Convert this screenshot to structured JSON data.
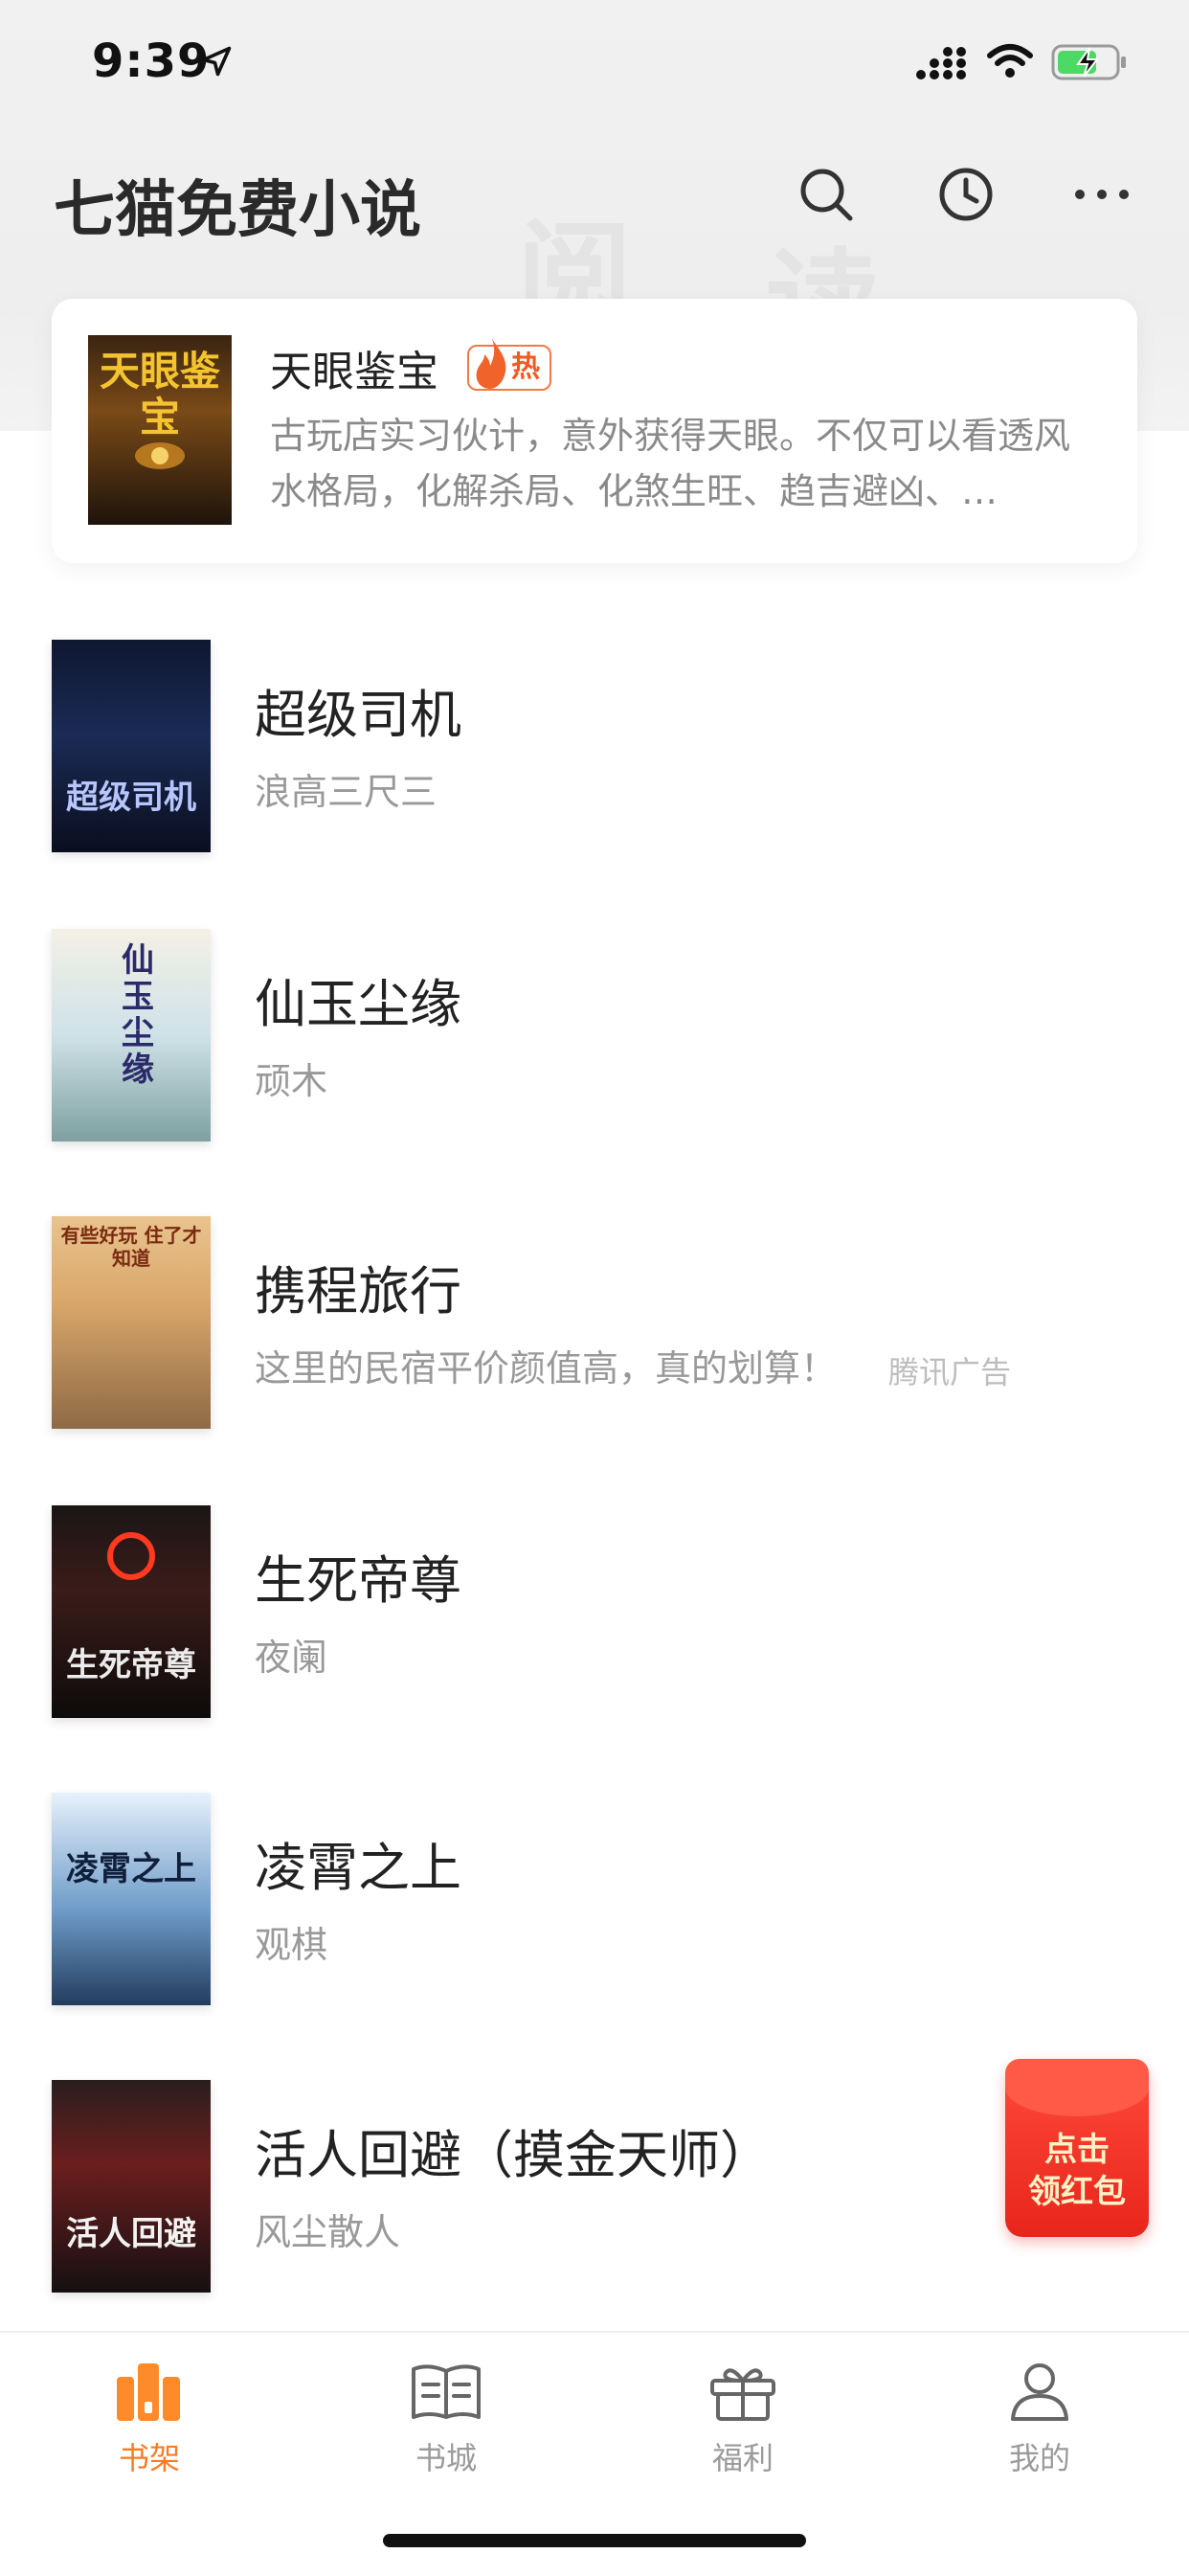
{
  "status_bar": {
    "time": "9:39"
  },
  "header": {
    "title": "七猫免费小说",
    "icons": [
      "search-icon",
      "history-clock-icon",
      "more-icon"
    ]
  },
  "promo": {
    "title": "天眼鉴宝",
    "badge": "热",
    "description": "古玩店实习伙计，意外获得天眼。不仅可以看透风水格局，化解杀局、化煞生旺、趋吉避凶、…",
    "cover_text": "天眼鉴宝"
  },
  "books": [
    {
      "title": "超级司机",
      "author": "浪高三尺三",
      "cover_text": "超级司机"
    },
    {
      "title": "仙玉尘缘",
      "author": "顽木",
      "cover_text": "仙玉尘缘"
    },
    {
      "title": "携程旅行",
      "author": "这里的民宿平价颜值高，真的划算！",
      "ad_tag": "腾讯广告",
      "cover_text": "有些好玩 住了才知道"
    },
    {
      "title": "生死帝尊",
      "author": "夜阑",
      "cover_text": "生死帝尊"
    },
    {
      "title": "凌霄之上",
      "author": "观棋",
      "cover_text": "凌霄之上"
    },
    {
      "title": "活人回避（摸金天师）",
      "author": "风尘散人",
      "cover_text": "活人回避"
    }
  ],
  "red_packet": {
    "line1": "点击",
    "line2": "领红包"
  },
  "tabs": [
    {
      "label": "书架",
      "icon": "bookshelf-icon",
      "active": true
    },
    {
      "label": "书城",
      "icon": "book-open-icon",
      "active": false
    },
    {
      "label": "福利",
      "icon": "gift-icon",
      "active": false
    },
    {
      "label": "我的",
      "icon": "person-icon",
      "active": false
    }
  ],
  "colors": {
    "accent": "#ff7a1f",
    "hot": "#ee5a24",
    "red_packet": "#e8251c"
  }
}
